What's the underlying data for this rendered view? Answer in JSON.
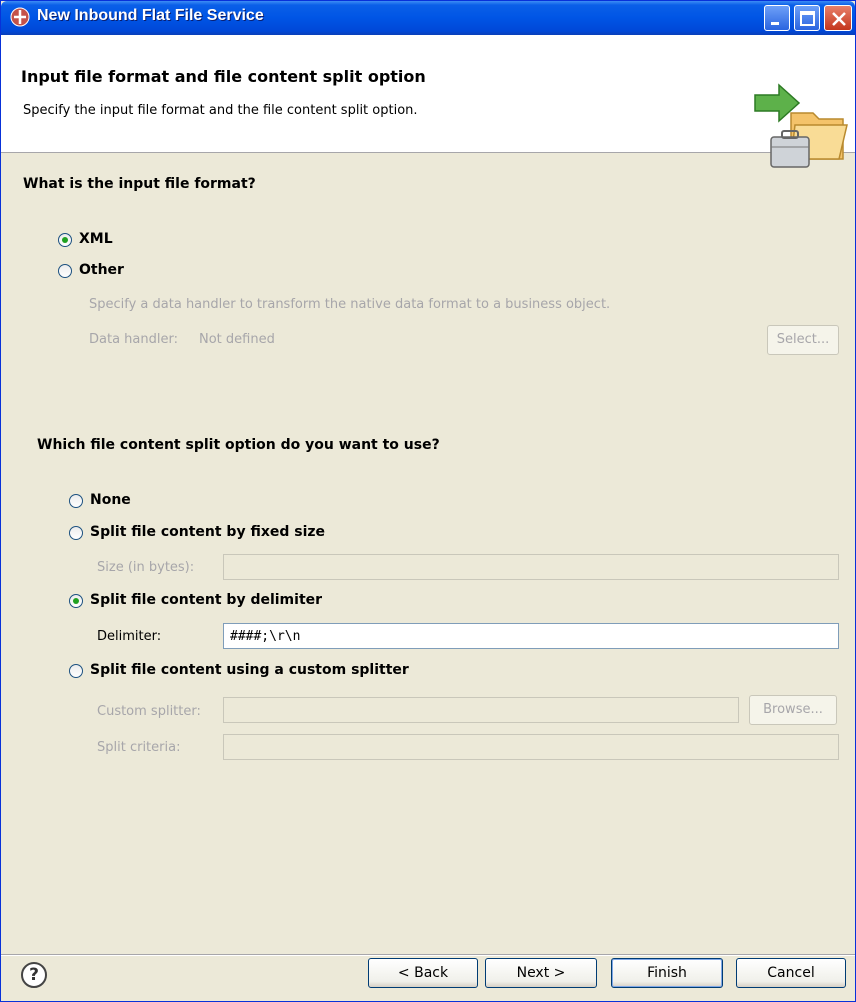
{
  "window": {
    "title": "New Inbound Flat File Service"
  },
  "header": {
    "title": "Input file format and file content split option",
    "description": "Specify the input file format and the file content split option."
  },
  "format": {
    "question": "What is the input file format?",
    "xml_label": "XML",
    "other_label": "Other",
    "other_desc": "Specify a data handler to transform the native data format to a business object.",
    "data_handler_label": "Data handler:",
    "data_handler_value": "Not defined",
    "select_button": "Select...",
    "selected": "XML"
  },
  "split": {
    "question": "Which file content split option do you want to use?",
    "none_label": "None",
    "fixed_label": "Split file content by fixed size",
    "size_label": "Size (in bytes):",
    "size_value": "",
    "delimiter_option_label": "Split file content by delimiter",
    "delimiter_label": "Delimiter:",
    "delimiter_value": "####;\\r\\n",
    "custom_label": "Split file content using a custom splitter",
    "custom_splitter_label": "Custom splitter:",
    "custom_splitter_value": "",
    "browse_button": "Browse...",
    "criteria_label": "Split criteria:",
    "criteria_value": "",
    "selected": "Split file content by delimiter"
  },
  "footer": {
    "help_icon": "?",
    "back_button": "< Back",
    "next_button": "Next >",
    "finish_button": "Finish",
    "cancel_button": "Cancel"
  },
  "colors": {
    "titlebar": "#0055e5",
    "dialog_bg": "#ece9d8",
    "disabled_text": "#a7a6aa",
    "radio_dot": "#21a121"
  }
}
